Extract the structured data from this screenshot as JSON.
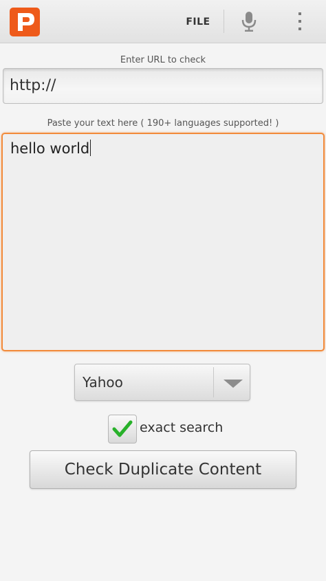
{
  "action_bar": {
    "app_icon": "duplicate-checker-logo",
    "file_label": "FILE",
    "mic_icon": "microphone-icon",
    "overflow_icon": "overflow-menu-icon"
  },
  "url_section": {
    "label": "Enter URL to check",
    "value": "http://"
  },
  "text_section": {
    "label": "Paste your text here ( 190+ languages supported! )",
    "value": "hello world"
  },
  "search_engine": {
    "selected": "Yahoo"
  },
  "exact_search": {
    "checked": true,
    "label": "exact search"
  },
  "check_button": {
    "label": "Check Duplicate Content"
  },
  "colors": {
    "accent_orange": "#f28a3a",
    "logo_orange": "#ee5a1a",
    "check_green": "#28b12a"
  }
}
